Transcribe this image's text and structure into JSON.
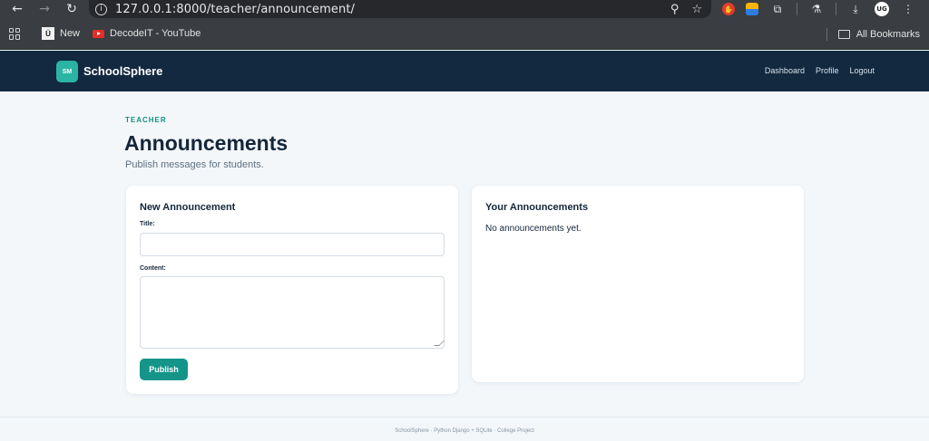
{
  "browser": {
    "url": "127.0.0.1:8000/teacher/announcement/",
    "bookmarks": [
      {
        "label": "New"
      },
      {
        "label": "DecodeIT - YouTube"
      }
    ],
    "all_bookmarks_label": "All Bookmarks",
    "icons": [
      "back-arrow-icon",
      "forward-arrow-icon",
      "reload-icon",
      "info-icon",
      "zoom-icon",
      "star-icon",
      "extension-icon",
      "puzzle-icon",
      "download-icon",
      "menu-icon"
    ]
  },
  "app": {
    "logo_text": "SM",
    "brand": "SchoolSphere",
    "nav": [
      "Dashboard",
      "Profile",
      "Logout"
    ],
    "accent_color": "#15958a",
    "header_color": "#12293f"
  },
  "page": {
    "eyebrow": "TEACHER",
    "title": "Announcements",
    "subtitle": "Publish messages for students."
  },
  "form": {
    "heading": "New Announcement",
    "title_label": "Title:",
    "title_value": "",
    "content_label": "Content:",
    "content_value": "",
    "submit_label": "Publish"
  },
  "list": {
    "heading": "Your Announcements",
    "empty_text": "No announcements yet."
  },
  "footer": {
    "text": "SchoolSphere · Python Django + SQLite · College Project"
  }
}
